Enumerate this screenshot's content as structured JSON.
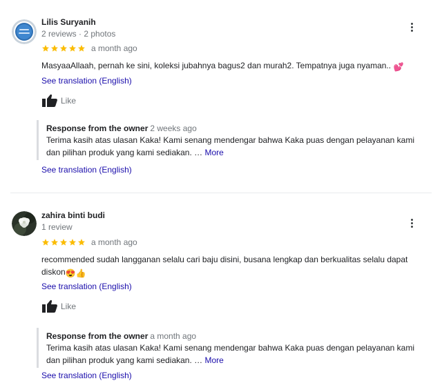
{
  "reviews": [
    {
      "author": "Lilis Suryanih",
      "meta": "2 reviews · 2 photos",
      "avatar_icon": "avatar-blue-badge-icon",
      "rating": 5,
      "time": "a month ago",
      "text": "MasyaaAllaah, pernah ke sini, koleksi jubahnya bagus2 dan murah2. Tempatnya juga nyaman.. ",
      "text_emoji": "💕",
      "translate_label": "See translation (English)",
      "like_label": "Like",
      "response": {
        "heading": "Response from the owner",
        "time": "2 weeks ago",
        "text": "Terima kasih atas ulasan Kaka! Kami senang mendengar bahwa Kaka puas dengan pelayanan kami dan pilihan produk yang kami sediakan. … ",
        "more_label": "More",
        "translate_label": "See translation (English)"
      }
    },
    {
      "author": "zahira binti budi",
      "meta": "1 review",
      "avatar_icon": "avatar-flower-photo-icon",
      "rating": 5,
      "time": "a month ago",
      "text": "recommended sudah langganan selalu cari baju disini, busana lengkap dan berkualitas selalu dapat diskon",
      "text_emoji": "😍👍",
      "translate_label": "See translation (English)",
      "like_label": "Like",
      "response": {
        "heading": "Response from the owner",
        "time": "a month ago",
        "text": "Terima kasih atas ulasan Kaka! Kami senang mendengar bahwa Kaka puas dengan pelayanan kami dan pilihan produk yang kami sediakan. … ",
        "more_label": "More",
        "translate_label": "See translation (English)"
      }
    }
  ],
  "colors": {
    "star": "#fbbc04",
    "link": "#1a0dab",
    "secondary_text": "#70757a",
    "primary_text": "#202124",
    "divider": "#e8eaed"
  }
}
